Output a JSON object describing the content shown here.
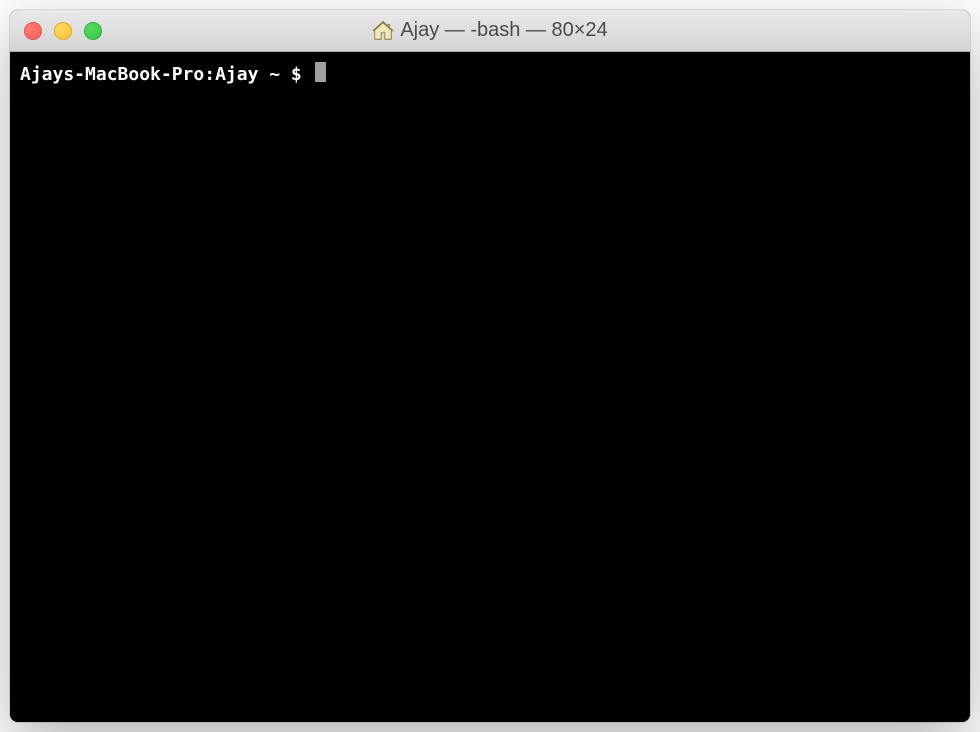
{
  "window": {
    "title_icon": "home-icon",
    "title": "Ajay — -bash — 80×24"
  },
  "terminal": {
    "prompt": "Ajays-MacBook-Pro:Ajay ~ $ "
  }
}
